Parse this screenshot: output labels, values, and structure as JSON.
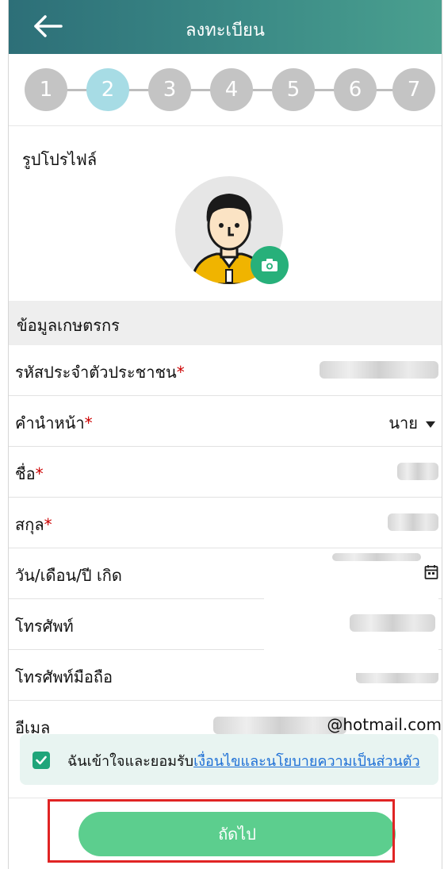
{
  "header": {
    "title": "ลงทะเบียน",
    "back_icon": "arrow-left-icon"
  },
  "steps": [
    "1",
    "2",
    "3",
    "4",
    "5",
    "6",
    "7"
  ],
  "active_step": 2,
  "profile": {
    "label": "รูปโปรไฟล์",
    "camera_icon": "camera-icon"
  },
  "section_title": "ข้อมูลเกษตรกร",
  "fields": {
    "id_label": "รหัสประจำตัวประชาชน",
    "title_label": "คำนำหน้า",
    "title_value": "นาย",
    "first_label": "ชื่อ",
    "last_label": "สกุล",
    "dob_label": "วัน/เดือน/ปี เกิด",
    "phone_label": "โทรศัพท์",
    "mobile_label": "โทรศัพท์มือถือ",
    "email_label": "อีเมล",
    "email_domain": "@hotmail.com"
  },
  "consent": {
    "text": "ฉันเข้าใจและยอมรับ",
    "link": "เงื่อนไขและนโยบายความเป็นส่วนตัว"
  },
  "next_label": "ถัดไป",
  "colors": {
    "header_start": "#2d6f78",
    "header_end": "#4aa08f",
    "accent": "#5cce8e",
    "active_step": "#a7dce5"
  }
}
